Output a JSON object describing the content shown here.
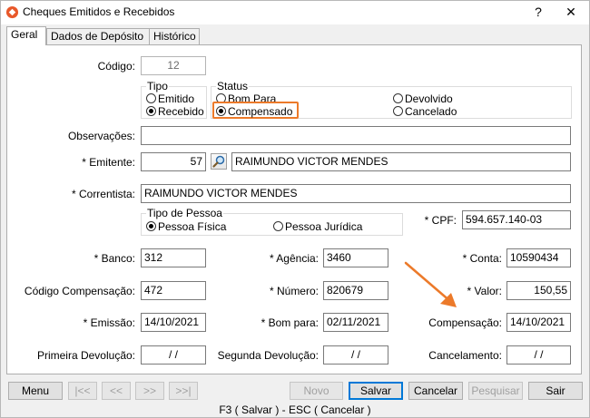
{
  "window": {
    "title": "Cheques Emitidos e Recebidos",
    "help_glyph": "?",
    "close_glyph": "✕"
  },
  "tabs": [
    "Geral",
    "Dados de Depósito",
    "Histórico"
  ],
  "form": {
    "codigo": {
      "label": "Código:",
      "value": "12"
    },
    "tipo": {
      "title": "Tipo",
      "options": [
        "Emitido",
        "Recebido"
      ],
      "selected": "Recebido"
    },
    "status": {
      "title": "Status",
      "options": [
        "Bom Para",
        "Compensado",
        "Devolvido",
        "Cancelado"
      ],
      "selected": "Compensado"
    },
    "observacoes": {
      "label": "Observações:",
      "value": ""
    },
    "emitente": {
      "label": "* Emitente:",
      "code": "57",
      "name": "RAIMUNDO VICTOR MENDES"
    },
    "correntista": {
      "label": "* Correntista:",
      "value": "RAIMUNDO VICTOR MENDES"
    },
    "tipo_pessoa": {
      "title": "Tipo de Pessoa",
      "options": [
        "Pessoa Física",
        "Pessoa Jurídica"
      ],
      "selected": "Pessoa Física"
    },
    "cpf": {
      "label": "* CPF:",
      "value": "594.657.140-03"
    },
    "banco": {
      "label": "* Banco:",
      "value": "312"
    },
    "agencia": {
      "label": "* Agência:",
      "value": "3460"
    },
    "conta": {
      "label": "* Conta:",
      "value": "10590434"
    },
    "codigo_compensacao": {
      "label": "Código Compensação:",
      "value": "472"
    },
    "numero": {
      "label": "* Número:",
      "value": "820679"
    },
    "valor": {
      "label": "* Valor:",
      "value": "150,55"
    },
    "emissao": {
      "label": "* Emissão:",
      "value": "14/10/2021"
    },
    "bom_para": {
      "label": "* Bom para:",
      "value": "02/11/2021"
    },
    "compensacao": {
      "label": "Compensação:",
      "value": "14/10/2021"
    },
    "primeira_devolucao": {
      "label": "Primeira Devolução:",
      "value": " /  / "
    },
    "segunda_devolucao": {
      "label": "Segunda Devolução:",
      "value": " /  / "
    },
    "cancelamento": {
      "label": "Cancelamento:",
      "value": " /  / "
    }
  },
  "buttons": {
    "menu": "Menu",
    "first": "|<<",
    "prev": "<<",
    "next": ">>",
    "last": ">>|",
    "novo": "Novo",
    "salvar": "Salvar",
    "cancelar": "Cancelar",
    "pesquisar": "Pesquisar",
    "sair": "Sair"
  },
  "statusbar": "F3 ( Salvar )  -  ESC ( Cancelar )",
  "colors": {
    "highlight": "#ec7a2a",
    "arrow": "#ec7a2a",
    "focus": "#0078d7"
  }
}
